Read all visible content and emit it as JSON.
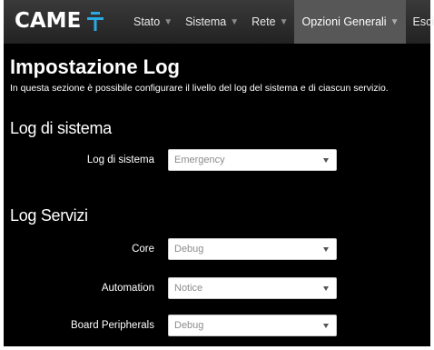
{
  "brand": {
    "logo_text": "CAME"
  },
  "nav": {
    "items": [
      {
        "label": "Stato",
        "caret": "▼"
      },
      {
        "label": "Sistema",
        "caret": "▼"
      },
      {
        "label": "Rete",
        "caret": "▼"
      },
      {
        "label": "Opzioni Generali",
        "caret": "▼"
      },
      {
        "label": "Esci"
      }
    ]
  },
  "page": {
    "title": "Impostazione Log",
    "description": "In questa sezione è possibile configurare il livello del log del sistema e di ciascun servizio."
  },
  "system_log": {
    "section_title": "Log di sistema",
    "row": {
      "label": "Log di sistema",
      "value": "Emergency"
    }
  },
  "services_log": {
    "section_title": "Log Servizi",
    "rows": [
      {
        "label": "Core",
        "value": "Debug"
      },
      {
        "label": "Automation",
        "value": "Notice"
      },
      {
        "label": "Board Peripherals",
        "value": "Debug"
      }
    ]
  },
  "colors": {
    "background": "#000000",
    "navbar": "#2e2e2e",
    "nav_active": "#575757",
    "logo_accent": "#29abe2",
    "select_text": "#8c8c8c"
  }
}
